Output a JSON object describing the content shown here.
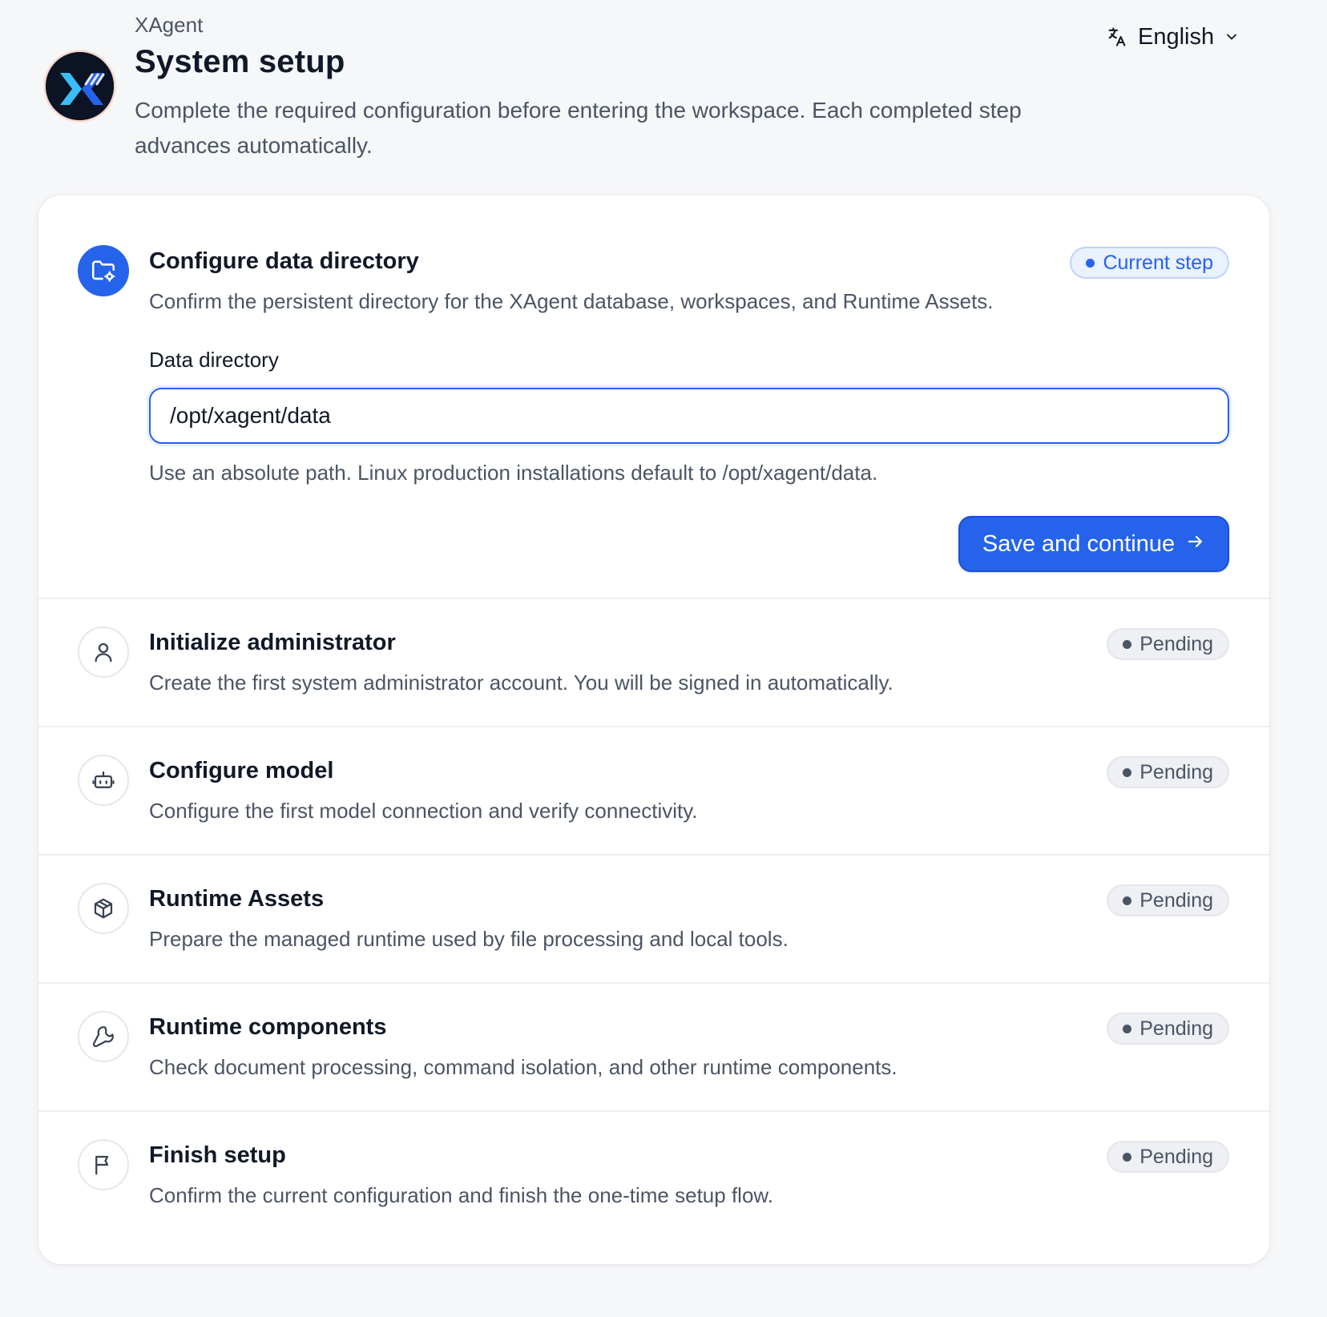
{
  "header": {
    "app_name": "XAgent",
    "title": "System setup",
    "description": "Complete the required configuration before entering the workspace. Each completed step advances automatically.",
    "language": "English"
  },
  "current_step": {
    "title": "Configure data directory",
    "description": "Confirm the persistent directory for the XAgent database, workspaces, and Runtime Assets.",
    "status": "Current step",
    "field_label": "Data directory",
    "field_value": "/opt/xagent/data",
    "hint": "Use an absolute path. Linux production installations default to /opt/xagent/data.",
    "button_label": "Save and continue"
  },
  "steps": [
    {
      "title": "Initialize administrator",
      "description": "Create the first system administrator account. You will be signed in automatically.",
      "status": "Pending",
      "icon": "user-icon"
    },
    {
      "title": "Configure model",
      "description": "Configure the first model connection and verify connectivity.",
      "status": "Pending",
      "icon": "robot-icon"
    },
    {
      "title": "Runtime Assets",
      "description": "Prepare the managed runtime used by file processing and local tools.",
      "status": "Pending",
      "icon": "package-icon"
    },
    {
      "title": "Runtime components",
      "description": "Check document processing, command isolation, and other runtime components.",
      "status": "Pending",
      "icon": "wrench-icon"
    },
    {
      "title": "Finish setup",
      "description": "Confirm the current configuration and finish the one-time setup flow.",
      "status": "Pending",
      "icon": "flag-icon"
    }
  ],
  "colors": {
    "accent": "#2563eb",
    "background": "#f6f7f9",
    "card": "#ffffff",
    "text": "#111827",
    "muted_text": "#4b5563"
  }
}
